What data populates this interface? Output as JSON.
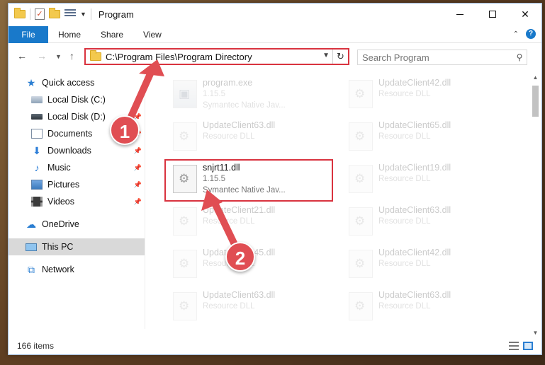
{
  "window": {
    "title": "Program",
    "controls": {
      "minimize": "–",
      "maximize": "□",
      "close": "✕"
    }
  },
  "ribbon": {
    "tabs": [
      "File",
      "Home",
      "Share",
      "View"
    ],
    "collapse_icon": "chevron-up-icon",
    "help": "?"
  },
  "navbar": {
    "address": "C:\\Program Files\\Program Directory",
    "search_placeholder": "Search Program"
  },
  "sidebar": {
    "items": [
      {
        "label": "Quick access",
        "icon": "star-icon",
        "pinned": false,
        "selected": false
      },
      {
        "label": "Local Disk (C:)",
        "icon": "drive-icon",
        "pinned": false,
        "selected": false
      },
      {
        "label": "Local Disk (D:)",
        "icon": "drive-icon",
        "pinned": true,
        "selected": false
      },
      {
        "label": "Documents",
        "icon": "documents-icon",
        "pinned": true,
        "selected": false
      },
      {
        "label": "Downloads",
        "icon": "download-icon",
        "pinned": true,
        "selected": false
      },
      {
        "label": "Music",
        "icon": "music-icon",
        "pinned": true,
        "selected": false
      },
      {
        "label": "Pictures",
        "icon": "pictures-icon",
        "pinned": true,
        "selected": false
      },
      {
        "label": "Videos",
        "icon": "videos-icon",
        "pinned": true,
        "selected": false
      },
      {
        "label": "OneDrive",
        "icon": "cloud-icon",
        "pinned": false,
        "selected": false
      },
      {
        "label": "This PC",
        "icon": "computer-icon",
        "pinned": false,
        "selected": true
      },
      {
        "label": "Network",
        "icon": "network-icon",
        "pinned": false,
        "selected": false
      }
    ]
  },
  "files": [
    {
      "name": "program.exe",
      "version": "1.15.5",
      "desc": "Symantec Native Jav...",
      "faded": true,
      "col": 0,
      "row": 0,
      "type": "exe"
    },
    {
      "name": "UpdateClient42.dll",
      "desc": "Resource DLL",
      "faded": true,
      "col": 1,
      "row": 0,
      "type": "dll"
    },
    {
      "name": "UpdateClient63.dll",
      "desc": "Resource DLL",
      "faded": true,
      "col": 0,
      "row": 1,
      "type": "dll"
    },
    {
      "name": "UpdateClient65.dll",
      "desc": "Resource DLL",
      "faded": true,
      "col": 1,
      "row": 1,
      "type": "dll"
    },
    {
      "name": "snjrt11.dll",
      "version": "1.15.5",
      "desc": "Symantec Native Jav...",
      "faded": false,
      "col": 0,
      "row": 2,
      "type": "dll"
    },
    {
      "name": "UpdateClient19.dll",
      "desc": "Resource DLL",
      "faded": true,
      "col": 1,
      "row": 2,
      "type": "dll"
    },
    {
      "name": "UpdateClient21.dll",
      "desc": "Resource DLL",
      "faded": true,
      "col": 0,
      "row": 3,
      "type": "dll"
    },
    {
      "name": "UpdateClient63.dll",
      "desc": "Resource DLL",
      "faded": true,
      "col": 1,
      "row": 3,
      "type": "dll"
    },
    {
      "name": "UpdateClient45.dll",
      "desc": "Resource DLL",
      "faded": true,
      "col": 0,
      "row": 4,
      "type": "dll"
    },
    {
      "name": "UpdateClient42.dll",
      "desc": "Resource DLL",
      "faded": true,
      "col": 1,
      "row": 4,
      "type": "dll"
    },
    {
      "name": "UpdateClient63.dll",
      "desc": "Resource DLL",
      "faded": true,
      "col": 0,
      "row": 5,
      "type": "dll"
    },
    {
      "name": "UpdateClient63.dll",
      "desc": "Resource DLL",
      "faded": true,
      "col": 1,
      "row": 5,
      "type": "dll"
    }
  ],
  "status": {
    "item_count": "166 items"
  },
  "annotations": [
    {
      "label": "1",
      "color": "#e04e53"
    },
    {
      "label": "2",
      "color": "#e04e53"
    }
  ],
  "colors": {
    "accent": "#1979ca",
    "highlight": "#d9333f",
    "annotation": "#e04e53"
  }
}
